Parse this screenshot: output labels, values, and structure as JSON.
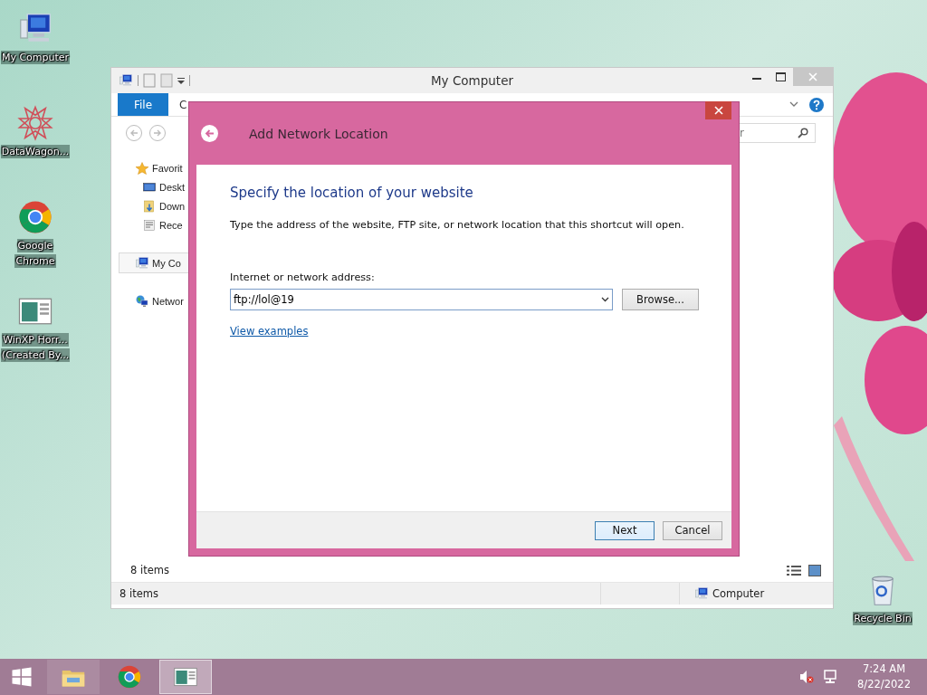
{
  "desktop": {
    "icons": [
      {
        "lines": [
          "My Computer"
        ],
        "kind": "computer"
      },
      {
        "lines": [
          "DataWagon..."
        ],
        "kind": "star"
      },
      {
        "lines": [
          "Google",
          "Chrome"
        ],
        "kind": "chrome"
      },
      {
        "lines": [
          "WinXP Horr...",
          "(Created By..."
        ],
        "kind": "doc"
      }
    ],
    "recycle_bin": {
      "lines": [
        "Recycle Bin"
      ],
      "kind": "bin"
    }
  },
  "explorer": {
    "title": "My Computer",
    "ribbon_tabs": [
      {
        "label": "File",
        "selected": true
      },
      {
        "label": "C",
        "selected": false
      }
    ],
    "search": {
      "placeholder": "r"
    },
    "nav": [
      {
        "label": "Favorit",
        "kind": "star",
        "selected": false,
        "children": [
          {
            "label": "Deskt",
            "kind": "desktop",
            "selected": false
          },
          {
            "label": "Down",
            "kind": "download",
            "selected": false
          },
          {
            "label": "Rece",
            "kind": "recent",
            "selected": false
          }
        ]
      },
      {
        "label": "My Co",
        "kind": "computer",
        "selected": true
      },
      {
        "label": "Networ",
        "kind": "network",
        "selected": false
      }
    ],
    "item_count": "8 items",
    "status_bar": {
      "count": "8 items",
      "location": "Computer"
    }
  },
  "dialog": {
    "title": "Add Network Location",
    "heading": "Specify the location of your website",
    "description": "Type the address of the website, FTP site, or network location that this shortcut will open.",
    "address_label": "Internet or network address:",
    "address_value": "ftp://lol@19",
    "browse_button": "Browse...",
    "link": "View examples",
    "buttons": [
      {
        "label": "Next",
        "default": true
      },
      {
        "label": "Cancel",
        "default": false
      }
    ]
  },
  "taskbar": {
    "apps": [
      {
        "kind": "folder",
        "active": false
      },
      {
        "kind": "chrome",
        "active": false
      },
      {
        "kind": "doc",
        "active": true
      }
    ],
    "time": "7:24 AM",
    "date": "8/22/2022"
  }
}
